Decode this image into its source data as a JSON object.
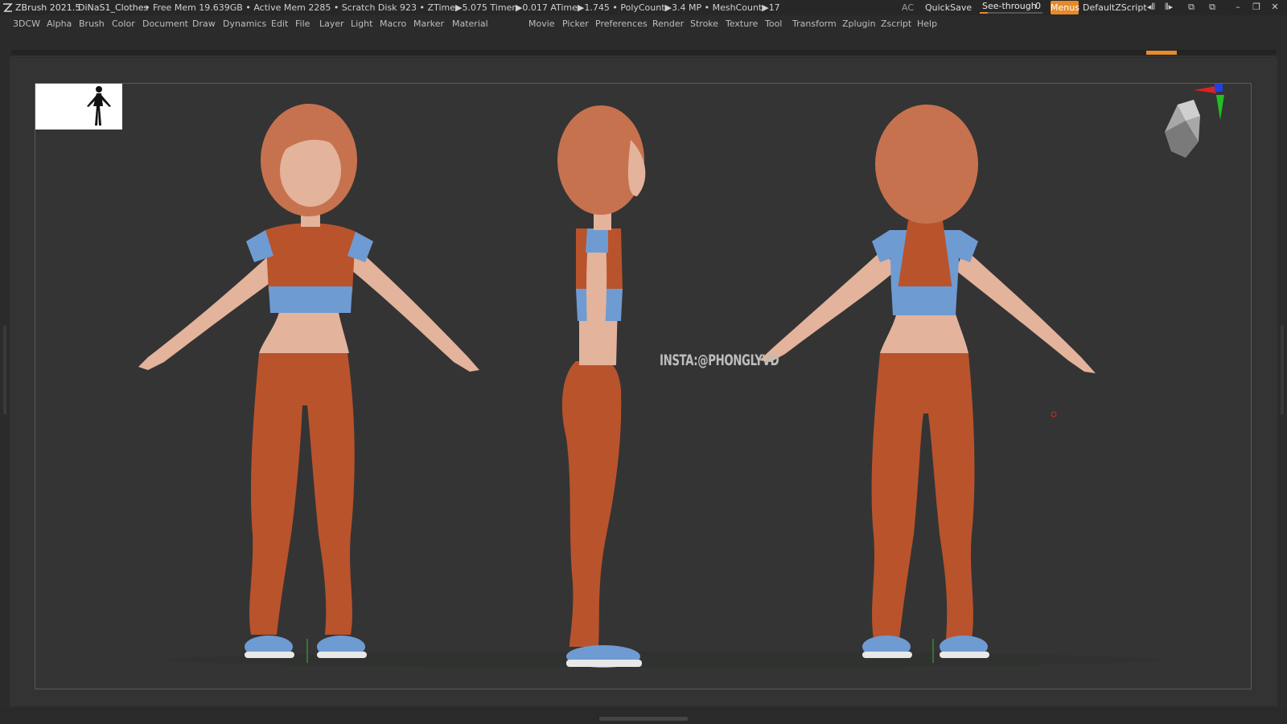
{
  "app": {
    "name": "ZBrush 2021.5",
    "document": "DiNaS1_Clothes",
    "stats": "• Free Mem 19.639GB • Active Mem 2285 • Scratch Disk 923 • ZTime▶5.075 Timer▶0.017 ATime▶1.745 • PolyCount▶3.4 MP • MeshCount▶17"
  },
  "titlebar": {
    "ac_label": "AC",
    "quicksave_label": "QuickSave",
    "seethrough_label": "See-through",
    "seethrough_value": "0",
    "menus_label": "Menus",
    "script_label": "DefaultZScript"
  },
  "menu": {
    "items": [
      "3DCW",
      "Alpha",
      "Brush",
      "Color",
      "Document",
      "Draw",
      "Dynamics",
      "Edit",
      "File",
      "Layer",
      "Light",
      "Macro",
      "Marker",
      "Material",
      "Movie",
      "Picker",
      "Preferences",
      "Render",
      "Stroke",
      "Texture",
      "Tool",
      "Transform",
      "Zplugin",
      "Zscript",
      "Help"
    ]
  },
  "viewport": {
    "watermark": "INSTA:@PHONGLYVD"
  },
  "colors": {
    "accent": "#e58a2a",
    "skin": "#e3b39c",
    "outfit_orange": "#b9532c",
    "outfit_blue": "#6f9bd3",
    "hair": "#c7724e"
  }
}
